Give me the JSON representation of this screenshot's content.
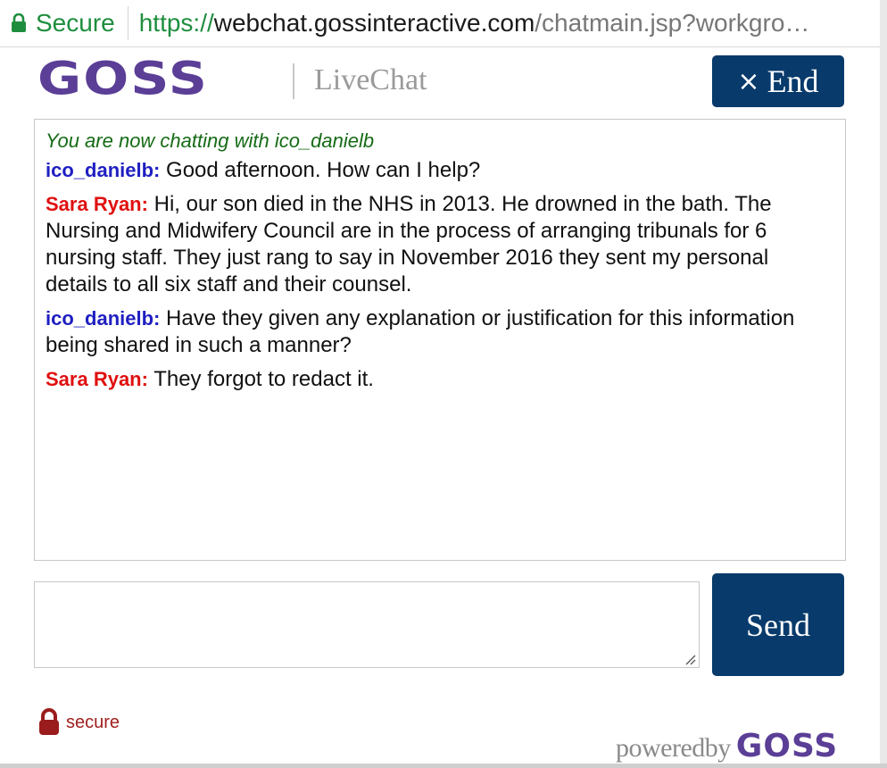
{
  "browser": {
    "secure_label": "Secure",
    "url_scheme": "https://",
    "url_host": "webchat.gossinteractive.com",
    "url_rest": "/chatmain.jsp?workgro…"
  },
  "header": {
    "logo_text": "GOSS",
    "product_name": "LiveChat",
    "end_icon": "×",
    "end_label": "End"
  },
  "chat": {
    "system_message": "You are now chatting with ico_danielb",
    "messages": [
      {
        "sender": "ico_danielb:",
        "role": "agent",
        "text": " Good afternoon. How can I help?"
      },
      {
        "sender": "Sara Ryan:",
        "role": "user",
        "text": " Hi, our son died in the NHS in 2013. He drowned in the bath. The Nursing and Midwifery Council are in the process of arranging tribunals for 6 nursing staff. They just rang to say in November 2016 they sent my personal details to all six staff and their counsel."
      },
      {
        "sender": "ico_danielb:",
        "role": "agent",
        "text": " Have they given any explanation or justification for this information being shared in such a manner?"
      },
      {
        "sender": "Sara Ryan:",
        "role": "user",
        "text": " They forgot to redact it."
      }
    ]
  },
  "composer": {
    "value": "",
    "send_label": "Send"
  },
  "footer": {
    "secure_label": "secure",
    "powered_by": "poweredby",
    "powered_logo": "GOSS"
  },
  "colors": {
    "brand_purple": "#5b3e96",
    "button_navy": "#083a6b",
    "agent_blue": "#1f1fc2",
    "user_red": "#e01010",
    "system_green": "#166b16"
  }
}
